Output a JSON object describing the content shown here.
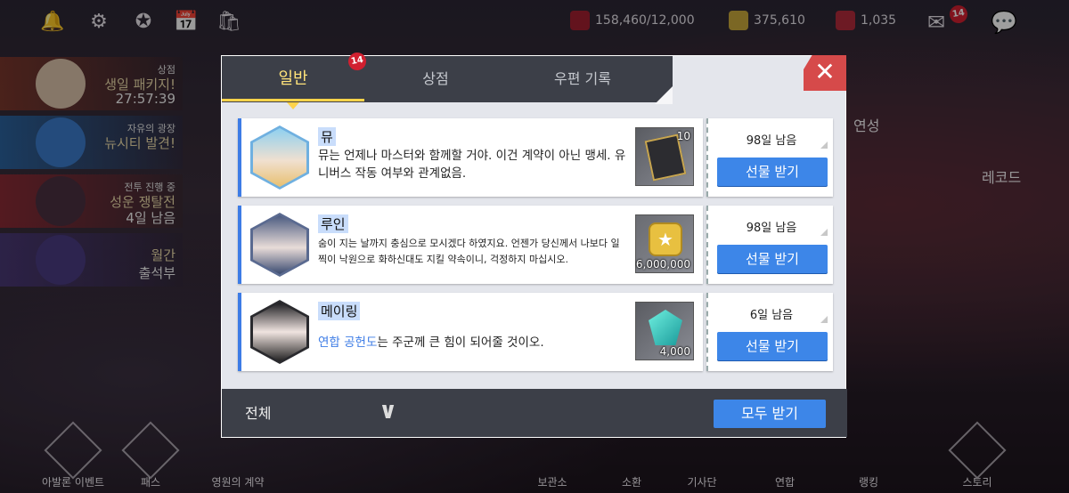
{
  "topbar": {
    "stamina": "158,460/12,000",
    "gold": "375,610",
    "crystal": "1,035",
    "mail_badge": "14"
  },
  "leftpanel": {
    "items": [
      {
        "caption": "상점",
        "text": "생일 패키지!",
        "sub": "27:57:39"
      },
      {
        "caption": "자유의 광장",
        "text": "뉴시티 발견!",
        "sub": ""
      },
      {
        "caption": "전투 진행 중",
        "text": "성운 쟁탈전",
        "sub": "4일 남음"
      },
      {
        "caption": "",
        "text": "월간",
        "sub": "출석부"
      }
    ]
  },
  "right": {
    "label_1": "연성",
    "label_2": "레코드"
  },
  "bottomnav": {
    "items": [
      "아발론 이벤트",
      "패스",
      "영원의 계약",
      "보관소",
      "소환",
      "기사단",
      "연합",
      "랭킹",
      "스토리"
    ]
  },
  "modal": {
    "tabs": [
      {
        "label": "일반",
        "badge": "14"
      },
      {
        "label": "상점"
      },
      {
        "label": "우편 기록"
      }
    ],
    "close_glyph": "✕",
    "messages": [
      {
        "sender": "뮤",
        "body": "뮤는 언제나 마스터와 함께할 거야. 이건 계약이 아닌 맹세. 유니버스 작동 여부와 관계없음.",
        "item_count": "10",
        "days_left": "98일 남음",
        "claim_label": "선물 받기"
      },
      {
        "sender": "루인",
        "body": "숨이 지는 날까지 충심으로 모시겠다 하였지요. 언젠가 당신께서 나보다 일찍이 낙원으로 화하신대도 지킬 약속이니, 걱정하지 마십시오.",
        "item_count": "6,000,000",
        "days_left": "98일 남음",
        "claim_label": "선물 받기"
      },
      {
        "sender": "메이링",
        "body_highlight": "연합 공헌도",
        "body_rest": "는 주군께 큰 힘이 되어줄 것이오.",
        "item_count": "4,000",
        "days_left": "6일 남음",
        "claim_label": "선물 받기"
      }
    ],
    "footer": {
      "filter_label": "전체",
      "claim_all_label": "모두 받기"
    }
  }
}
